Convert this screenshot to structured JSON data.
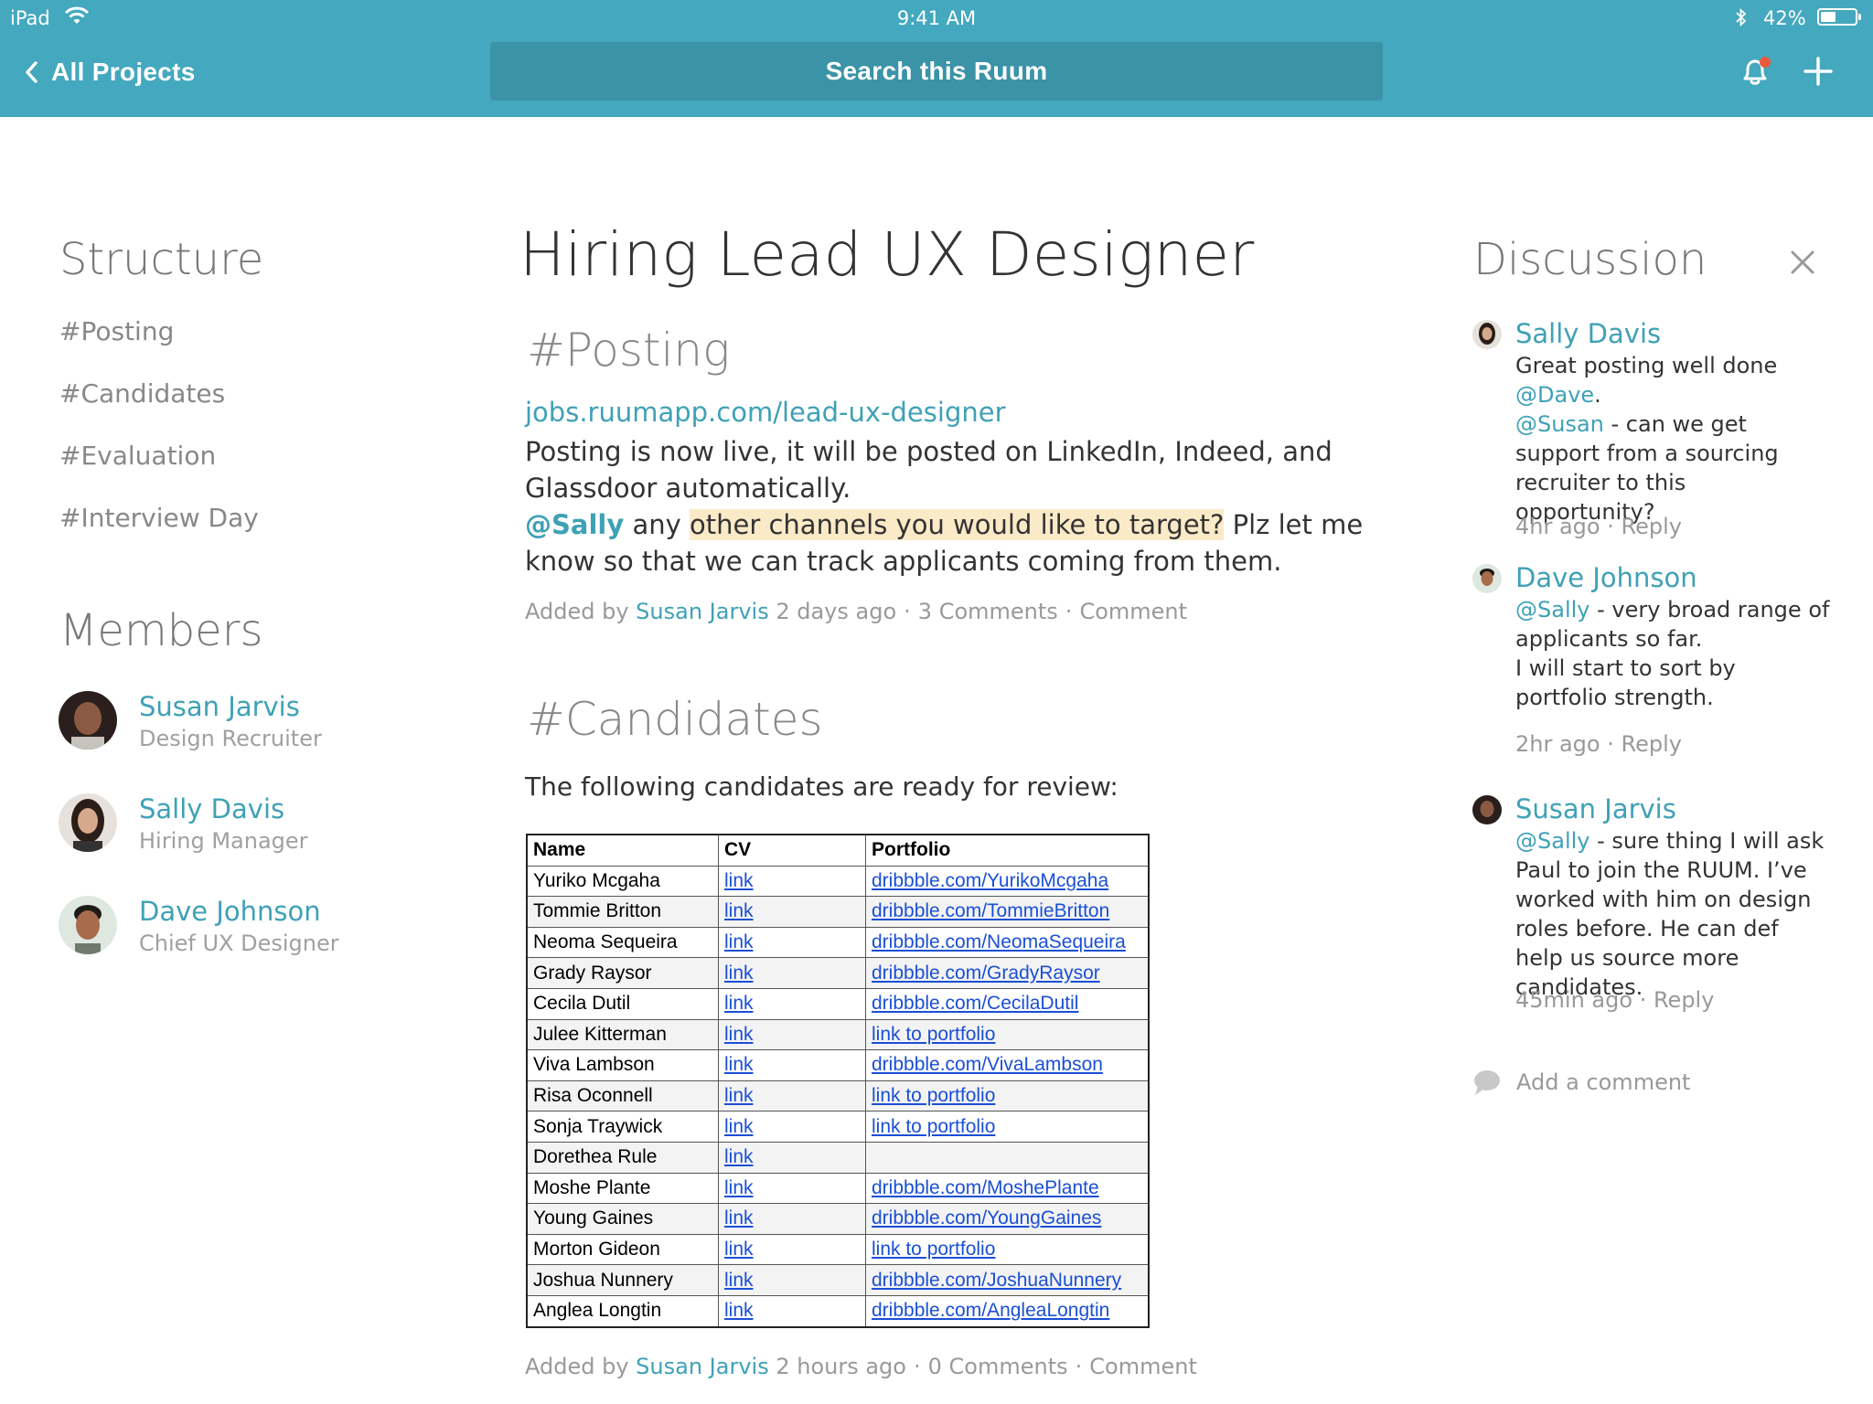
{
  "status": {
    "carrier": "iPad",
    "time": "9:41 AM",
    "battery": "42%",
    "battery_level": 0.42
  },
  "nav": {
    "back_label": "All Projects",
    "search_label": "Search this Ruum",
    "icons": [
      "chevron-left-icon",
      "bell-icon",
      "plus-icon"
    ]
  },
  "structure": {
    "title": "Structure",
    "items": [
      "#Posting",
      "#Candidates",
      "#Evaluation",
      "#Interview Day"
    ]
  },
  "members": {
    "title": "Members",
    "list": [
      {
        "name": "Susan Jarvis",
        "role": "Design Recruiter"
      },
      {
        "name": "Sally Davis",
        "role": "Hiring Manager"
      },
      {
        "name": "Dave Johnson",
        "role": "Chief UX Designer"
      }
    ]
  },
  "main": {
    "title": "Hiring Lead UX Designer",
    "posting": {
      "heading": "#Posting",
      "link": "jobs.ruumapp.com/lead-ux-designer",
      "line1": "Posting is now live, it will be posted on LinkedIn, Indeed, and Glassdoor automatically.",
      "mention": "@Sally",
      "text_any": " any ",
      "highlight": "other channels you would like to target?",
      "text_after": " Plz let me know so that we can track applicants coming from them.",
      "meta_added": "Added by",
      "meta_author": "Susan Jarvis",
      "meta_time": "2 days ago",
      "meta_comments": "3 Comments",
      "meta_comment": "Comment"
    },
    "candidates": {
      "heading": "#Candidates",
      "intro": "The following candidates are ready for review:",
      "columns": [
        "Name",
        "CV",
        "Portfolio"
      ],
      "rows": [
        [
          "Yuriko Mcgaha",
          "link",
          "dribbble.com/YurikoMcgaha"
        ],
        [
          "Tommie Britton",
          "link",
          "dribbble.com/TommieBritton"
        ],
        [
          "Neoma Sequeira",
          "link",
          "dribbble.com/NeomaSequeira"
        ],
        [
          "Grady Raysor",
          "link",
          "dribbble.com/GradyRaysor"
        ],
        [
          "Cecila Dutil",
          "link",
          "dribbble.com/CecilaDutil"
        ],
        [
          "Julee Kitterman",
          "link",
          "link to portfolio"
        ],
        [
          "Viva Lambson",
          "link",
          "dribbble.com/VivaLambson"
        ],
        [
          "Risa Oconnell",
          "link",
          "link to portfolio"
        ],
        [
          "Sonja Traywick",
          "link",
          "link to portfolio"
        ],
        [
          "Dorethea Rule",
          "link",
          ""
        ],
        [
          "Moshe Plante",
          "link",
          "dribbble.com/MoshePlante"
        ],
        [
          "Young Gaines",
          "link",
          "dribbble.com/YoungGaines"
        ],
        [
          "Morton Gideon",
          "link",
          "link to portfolio"
        ],
        [
          "Joshua Nunnery",
          "link",
          "dribbble.com/JoshuaNunnery"
        ],
        [
          "Anglea Longtin",
          "link",
          "dribbble.com/AngleaLongtin"
        ]
      ],
      "meta_added": "Added by",
      "meta_author": "Susan Jarvis",
      "meta_time": "2 hours ago",
      "meta_comments": "0 Comments",
      "meta_comment": "Comment"
    }
  },
  "discussion": {
    "title": "Discussion",
    "comments": [
      {
        "author": "Sally Davis",
        "parts": [
          "Great posting well done",
          "@Dave",
          ".",
          "@Susan",
          " - can we get support from a sourcing recruiter to this opportunity?"
        ],
        "time": "4hr ago",
        "reply": "Reply"
      },
      {
        "author": "Dave Johnson",
        "parts": [
          "@Sally",
          " - very broad range of applicants so far.",
          "I will start to sort by portfolio strength."
        ],
        "time": "2hr ago",
        "reply": "Reply"
      },
      {
        "author": "Susan Jarvis",
        "parts": [
          "@Sally",
          " - sure thing I will ask Paul to join the RUUM. I’ve worked with him on design roles before. He can def help us source more candidates."
        ],
        "time": "45min ago",
        "reply": "Reply"
      }
    ],
    "add_comment": "Add a comment"
  },
  "colors": {
    "header": "#44a8be",
    "search": "#3a93a6",
    "accent": "#3fa1b6",
    "highlight": "#fbeac7",
    "link_blue": "#1a4fd6"
  }
}
